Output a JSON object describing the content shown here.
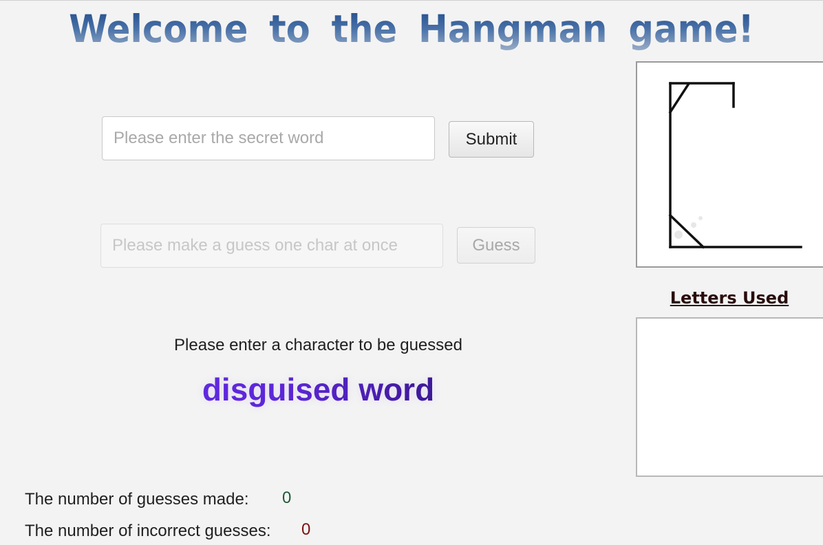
{
  "title": "Welcome to the Hangman game!",
  "secret_word": {
    "placeholder": "Please enter the secret word",
    "value": "",
    "submit_label": "Submit"
  },
  "guess": {
    "placeholder": "Please make a guess one char at once",
    "value": "",
    "guess_label": "Guess",
    "enabled": false
  },
  "prompt": "Please enter a character to be guessed",
  "disguised_word": "disguised word",
  "letters_used": {
    "heading": "Letters Used",
    "letters": []
  },
  "stats": {
    "guesses_made_label": "The number of guesses made:",
    "guesses_made_value": "0",
    "incorrect_label": "The number of incorrect guesses:",
    "incorrect_value": "0"
  },
  "colors": {
    "title_gradient": [
      "#1f4a8a",
      "#9aaec8"
    ],
    "guesses_made_value": "#1f5a3a",
    "incorrect_value": "#7a1010",
    "disguised_gradient": [
      "#6a2ef0",
      "#120a30"
    ]
  },
  "hangman_image": {
    "stage": 0,
    "icon": "gallows-icon"
  }
}
